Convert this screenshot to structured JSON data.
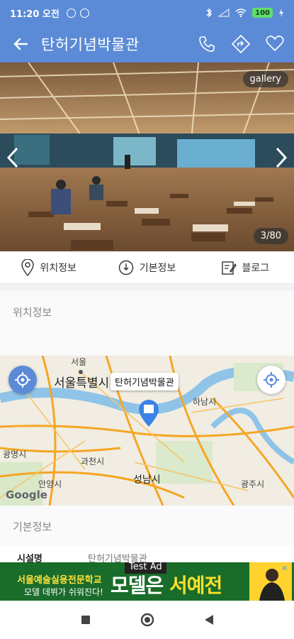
{
  "status": {
    "time": "11:20 오전",
    "battery": "100"
  },
  "appbar": {
    "title": "탄허기념박물관"
  },
  "gallery": {
    "button_label": "gallery",
    "counter": "3/80"
  },
  "tabs": [
    {
      "label": "위치정보",
      "icon": "location-pin-icon"
    },
    {
      "label": "기본정보",
      "icon": "info-down-icon"
    },
    {
      "label": "블로그",
      "icon": "blog-edit-icon"
    }
  ],
  "sections": {
    "location_title": "위치정보",
    "basic_title": "기본정보"
  },
  "map": {
    "poi_label": "탄허기념박물관",
    "places": [
      "서울",
      "서울특별시",
      "하남시",
      "광명시",
      "과천시",
      "안양시",
      "성남시",
      "광주시"
    ],
    "attribution": "Google"
  },
  "info": {
    "key": "시설명",
    "value": "탄허기념박물관"
  },
  "ad": {
    "tag": "Test Ad",
    "line1": "서울예술실용전문학교",
    "line2": "모델 데뷔가 쉬워진다!",
    "headline_a": "모델은 ",
    "headline_b": "서예전"
  },
  "colors": {
    "primary": "#5b8bd6",
    "ad_bg": "#1a6c2b"
  }
}
